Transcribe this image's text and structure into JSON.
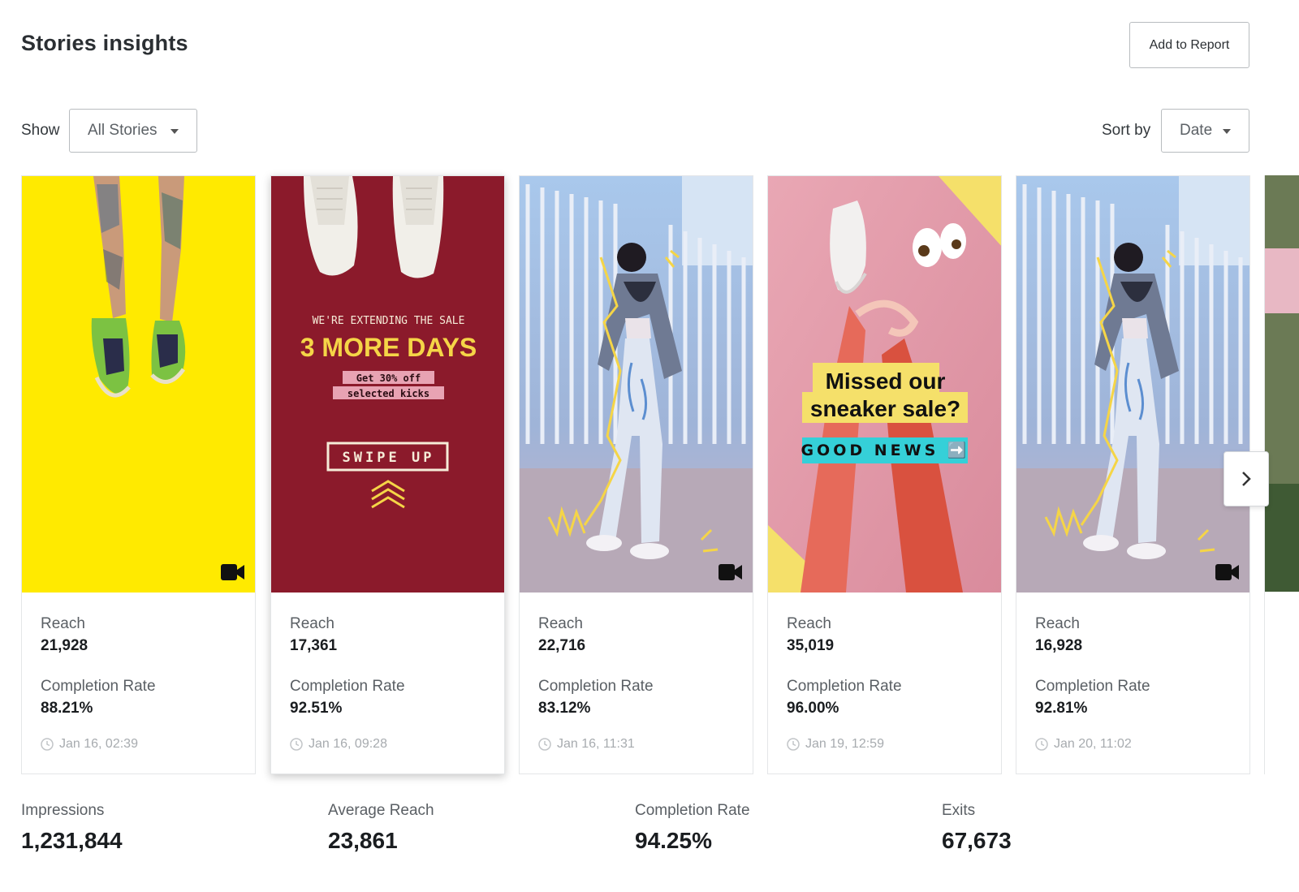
{
  "header": {
    "title": "Stories insights",
    "add_to_report": "Add to Report"
  },
  "filters": {
    "show_label": "Show",
    "show_value": "All Stories",
    "sort_label": "Sort by",
    "sort_value": "Date"
  },
  "stories": [
    {
      "reach_label": "Reach",
      "reach": "21,928",
      "completion_label": "Completion Rate",
      "completion": "88.21%",
      "date": "Jan 16, 02:39",
      "is_video": true
    },
    {
      "reach_label": "Reach",
      "reach": "17,361",
      "completion_label": "Completion Rate",
      "completion": "92.51%",
      "date": "Jan 16, 09:28",
      "is_video": false,
      "overlay": {
        "line1": "WE'RE EXTENDING THE SALE",
        "line2": "3 MORE DAYS",
        "line3": "Get 30% off",
        "line4": "selected kicks",
        "cta": "SWIPE UP"
      }
    },
    {
      "reach_label": "Reach",
      "reach": "22,716",
      "completion_label": "Completion Rate",
      "completion": "83.12%",
      "date": "Jan 16, 11:31",
      "is_video": true
    },
    {
      "reach_label": "Reach",
      "reach": "35,019",
      "completion_label": "Completion Rate",
      "completion": "96.00%",
      "date": "Jan 19, 12:59",
      "is_video": false,
      "overlay": {
        "line1": "Missed our",
        "line2": "sneaker sale?",
        "cta": "GOOD NEWS ➡️"
      }
    },
    {
      "reach_label": "Reach",
      "reach": "16,928",
      "completion_label": "Completion Rate",
      "completion": "92.81%",
      "date": "Jan 20, 11:02",
      "is_video": true
    }
  ],
  "summary": [
    {
      "label": "Impressions",
      "value": "1,231,844"
    },
    {
      "label": "Average Reach",
      "value": "23,861"
    },
    {
      "label": "Completion Rate",
      "value": "94.25%"
    },
    {
      "label": "Exits",
      "value": "67,673"
    }
  ],
  "icons": {
    "video": "video-camera-icon",
    "clock": "clock-icon",
    "next": "chevron-right-icon",
    "caret": "caret-down-icon"
  },
  "colors": {
    "yellow": "#ffea00",
    "maroon": "#8b1a2b",
    "accent_yellow": "#f5d547",
    "teal": "#35d0d8"
  }
}
